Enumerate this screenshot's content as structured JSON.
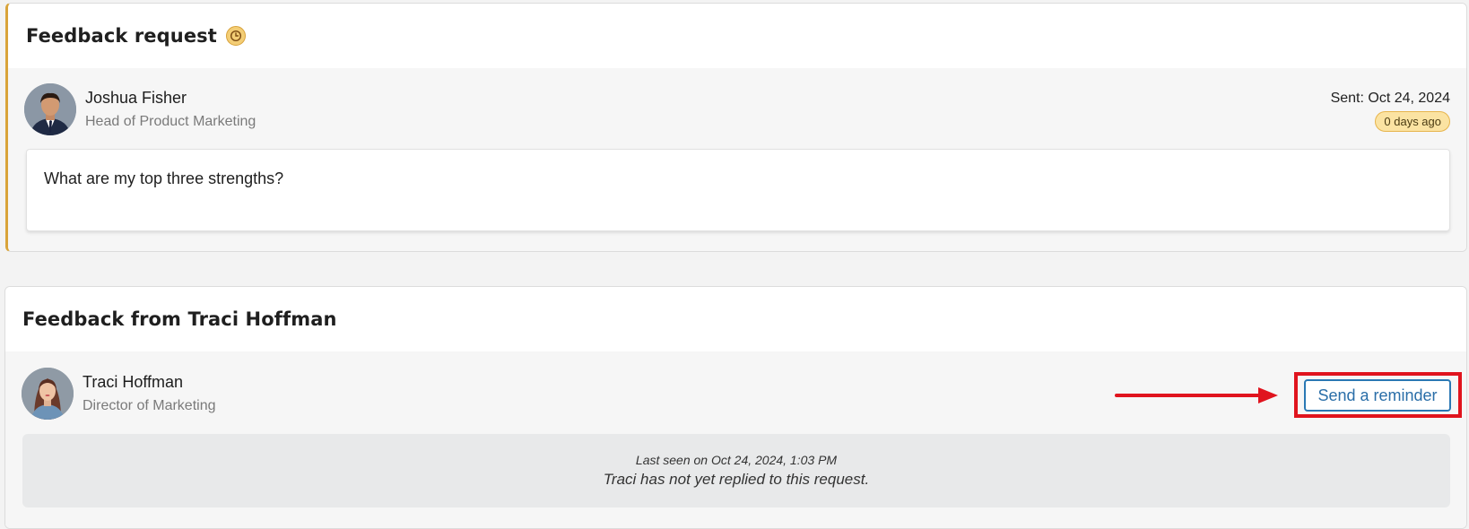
{
  "request_card": {
    "title": "Feedback request",
    "requester": {
      "name": "Joshua Fisher",
      "role": "Head of Product Marketing"
    },
    "sent_date": "Sent: Oct 24, 2024",
    "age_badge": "0 days ago",
    "question": "What are my top three strengths?"
  },
  "feedback_card": {
    "title": "Feedback from Traci Hoffman",
    "respondent": {
      "name": "Traci Hoffman",
      "role": "Director of Marketing"
    },
    "reminder_button_label": "Send a reminder",
    "last_seen": "Last seen on Oct 24, 2024, 1:03 PM",
    "status_message": "Traci has not yet replied to this request."
  },
  "icons": {
    "pending": "clock-icon",
    "annotation": "arrow-right-icon"
  },
  "colors": {
    "pending_accent": "#d9a43a",
    "badge_bg": "#fbe3a2",
    "button_blue": "#2a78b4",
    "annotation_red": "#e0141e"
  }
}
